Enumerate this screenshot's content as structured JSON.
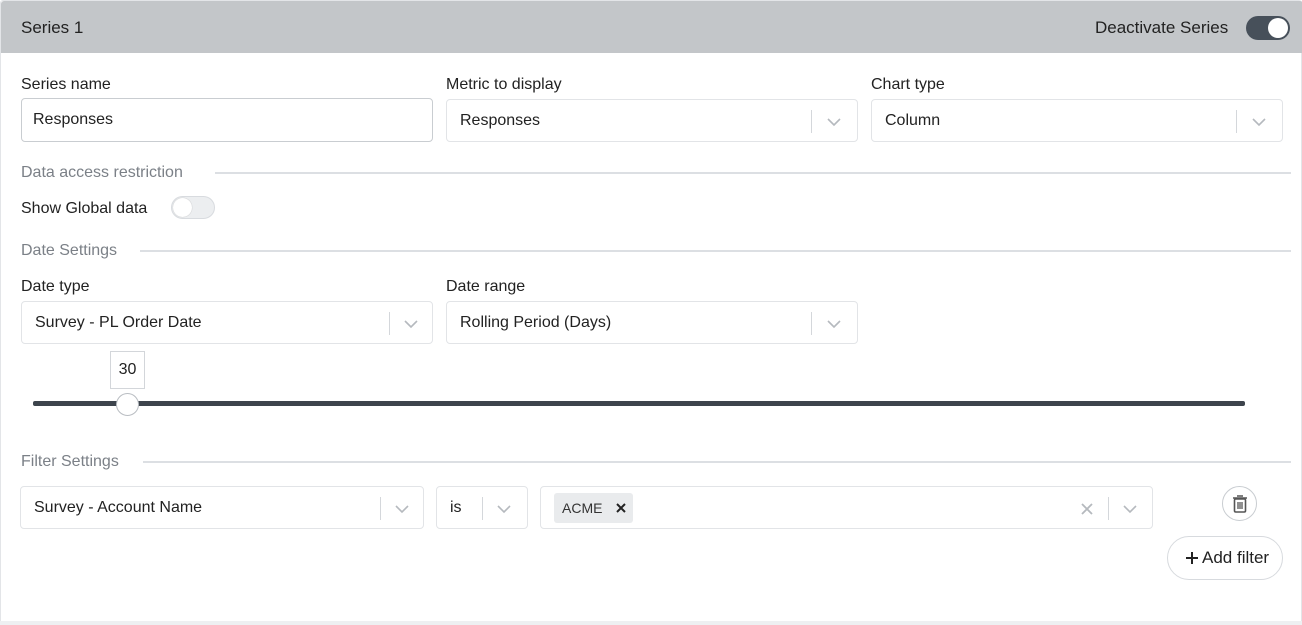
{
  "header": {
    "title": "Series 1",
    "deactivate_label": "Deactivate Series",
    "deactivate_on": true
  },
  "series_name": {
    "label": "Series name",
    "value": "Responses"
  },
  "metric": {
    "label": "Metric to display",
    "value": "Responses"
  },
  "chart_type": {
    "label": "Chart type",
    "value": "Column"
  },
  "data_access": {
    "title": "Data access restriction",
    "show_global_label": "Show Global data",
    "show_global_on": false
  },
  "date_settings": {
    "title": "Date Settings",
    "date_type_label": "Date type",
    "date_type_value": "Survey - PL Order Date",
    "date_range_label": "Date range",
    "date_range_value": "Rolling Period (Days)",
    "slider_value": "30"
  },
  "filter_settings": {
    "title": "Filter Settings",
    "field_value": "Survey - Account Name",
    "operator_value": "is",
    "chips": [
      "ACME"
    ],
    "add_filter_label": "Add filter"
  },
  "icons": {
    "chevron": "chevron-down-icon",
    "clear": "clear-icon",
    "trash": "trash-icon",
    "plus": "plus-icon",
    "chip_remove": "remove-chip-icon"
  }
}
